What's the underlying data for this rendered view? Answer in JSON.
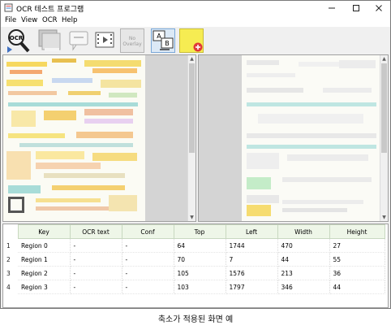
{
  "window": {
    "title": "OCR 테스트 프로그램"
  },
  "menu": [
    "File",
    "View",
    "OCR",
    "Help"
  ],
  "toolbar": {
    "ocr_label": "OCR",
    "no_overlay_label_1": "No",
    "no_overlay_label_2": "Overlay",
    "ab_a": "A",
    "ab_b": "B"
  },
  "table": {
    "headers": [
      "Key",
      "OCR text",
      "Conf",
      "Top",
      "Left",
      "Width",
      "Height"
    ],
    "rows": [
      {
        "num": "1",
        "cells": [
          "Region 0",
          "-",
          "-",
          "64",
          "1744",
          "470",
          "27"
        ]
      },
      {
        "num": "2",
        "cells": [
          "Region 1",
          "-",
          "-",
          "70",
          "7",
          "44",
          "55"
        ]
      },
      {
        "num": "3",
        "cells": [
          "Region 2",
          "-",
          "-",
          "105",
          "1576",
          "213",
          "36"
        ]
      },
      {
        "num": "4",
        "cells": [
          "Region 3",
          "-",
          "-",
          "103",
          "1797",
          "346",
          "44"
        ]
      }
    ]
  },
  "caption": "축소가 적용된 화면 예"
}
